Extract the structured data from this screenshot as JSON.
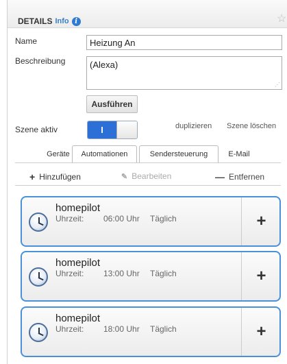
{
  "header": {
    "title": "DETAILS",
    "subtitle": "Info",
    "info_icon": "info-icon",
    "favorite_icon": "star-icon"
  },
  "form": {
    "name_label": "Name",
    "name_value": "Heizung An",
    "description_label": "Beschreibung",
    "description_value": "(Alexa)",
    "run_button": "Ausführen",
    "scene_active_label": "Szene aktiv",
    "scene_active_toggle": "I",
    "duplicate_link": "duplizieren",
    "delete_link": "Szene löschen"
  },
  "tabs": [
    {
      "label": "Geräte",
      "selected": false
    },
    {
      "label": "Automationen",
      "selected": true
    },
    {
      "label": "Sendersteuerung",
      "selected": false
    },
    {
      "label": "E-Mail",
      "selected": false
    }
  ],
  "toolbar": {
    "add": {
      "label": "Hinzufügen",
      "icon": "plus-icon"
    },
    "edit": {
      "label": "Bearbeiten",
      "icon": "pencil-icon"
    },
    "remove": {
      "label": "Entfernen",
      "icon": "minus-icon"
    }
  },
  "automations": [
    {
      "name": "homepilot",
      "time_label": "Uhrzeit:",
      "time": "06:00 Uhr",
      "repeat": "Täglich",
      "icon": "clock-icon"
    },
    {
      "name": "homepilot",
      "time_label": "Uhrzeit:",
      "time": "13:00 Uhr",
      "repeat": "Täglich",
      "icon": "clock-icon"
    },
    {
      "name": "homepilot",
      "time_label": "Uhrzeit:",
      "time": "18:00 Uhr",
      "repeat": "Täglich",
      "icon": "clock-icon"
    }
  ],
  "card_action_label": "+",
  "colors": {
    "accent": "#2c6fd6",
    "card_border": "#4a90d9"
  }
}
